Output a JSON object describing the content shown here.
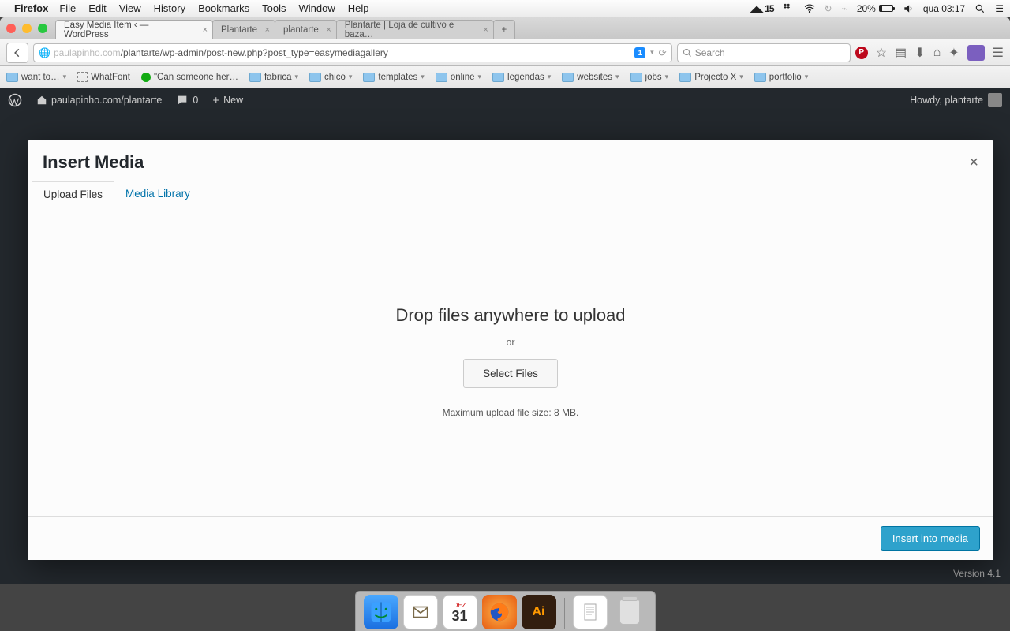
{
  "menubar": {
    "app": "Firefox",
    "items": [
      "File",
      "Edit",
      "View",
      "History",
      "Bookmarks",
      "Tools",
      "Window",
      "Help"
    ],
    "right": {
      "adobe_count": "15",
      "battery_pct": "20%",
      "clock": "qua 03:17"
    }
  },
  "browser": {
    "tabs": [
      {
        "label": "Easy Media Item ‹ — WordPress",
        "active": true
      },
      {
        "label": "Plantarte",
        "active": false
      },
      {
        "label": "plantarte",
        "active": false
      },
      {
        "label": "Plantarte | Loja de cultivo e baza…",
        "active": false
      }
    ],
    "url": {
      "host": "paulapinho.com",
      "path": "/plantarte/wp-admin/post-new.php?post_type=easymediagallery"
    },
    "search_placeholder": "Search",
    "bookmarks": [
      "want to…",
      "WhatFont",
      "\"Can someone her…",
      "fabrica",
      "chico",
      "templates",
      "online",
      "legendas",
      "websites",
      "jobs",
      "Projecto X",
      "portfolio"
    ]
  },
  "wpbar": {
    "site": "paulapinho.com/plantarte",
    "comments": "0",
    "new": "New",
    "howdy": "Howdy, plantarte"
  },
  "modal": {
    "title": "Insert Media",
    "tabs": {
      "upload": "Upload Files",
      "library": "Media Library"
    },
    "drop_heading": "Drop files anywhere to upload",
    "or": "or",
    "select_btn": "Select Files",
    "max_msg": "Maximum upload file size: 8 MB.",
    "insert_btn": "Insert into media"
  },
  "wp_footer": "Version 4.1",
  "dock": {
    "cal_month": "DEZ",
    "cal_day": "31",
    "ai": "Ai"
  }
}
